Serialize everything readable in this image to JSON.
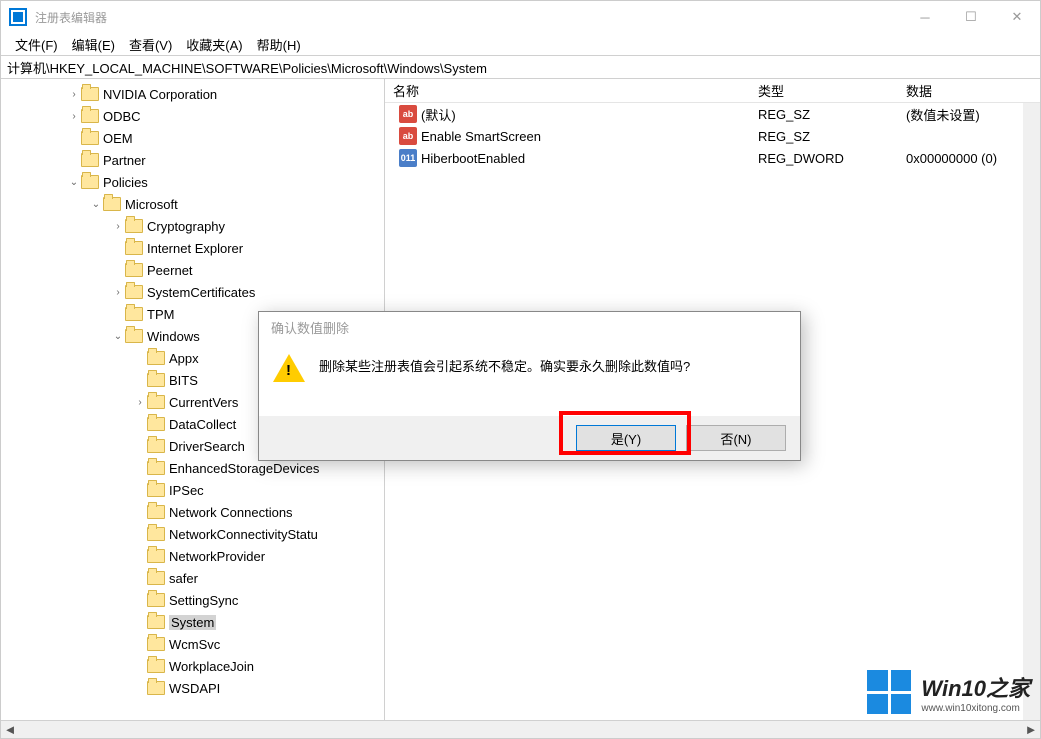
{
  "window": {
    "title": "注册表编辑器"
  },
  "menu": {
    "file": "文件(F)",
    "edit": "编辑(E)",
    "view": "查看(V)",
    "favorites": "收藏夹(A)",
    "help": "帮助(H)"
  },
  "path": "计算机\\HKEY_LOCAL_MACHINE\\SOFTWARE\\Policies\\Microsoft\\Windows\\System",
  "columns": {
    "name": "名称",
    "type": "类型",
    "data": "数据"
  },
  "values": [
    {
      "icon": "sz",
      "name": "(默认)",
      "type": "REG_SZ",
      "data": "(数值未设置)"
    },
    {
      "icon": "sz",
      "name": "Enable SmartScreen",
      "type": "REG_SZ",
      "data": ""
    },
    {
      "icon": "dw",
      "name": "HiberbootEnabled",
      "type": "REG_DWORD",
      "data": "0x00000000 (0)"
    }
  ],
  "tree": [
    {
      "indent": 3,
      "chev": "›",
      "label": "NVIDIA Corporation"
    },
    {
      "indent": 3,
      "chev": "›",
      "label": "ODBC"
    },
    {
      "indent": 3,
      "chev": "",
      "label": "OEM"
    },
    {
      "indent": 3,
      "chev": "",
      "label": "Partner"
    },
    {
      "indent": 3,
      "chev": "⌄",
      "label": "Policies"
    },
    {
      "indent": 4,
      "chev": "⌄",
      "label": "Microsoft"
    },
    {
      "indent": 5,
      "chev": "›",
      "label": "Cryptography"
    },
    {
      "indent": 5,
      "chev": "",
      "label": "Internet Explorer"
    },
    {
      "indent": 5,
      "chev": "",
      "label": "Peernet"
    },
    {
      "indent": 5,
      "chev": "›",
      "label": "SystemCertificates"
    },
    {
      "indent": 5,
      "chev": "",
      "label": "TPM"
    },
    {
      "indent": 5,
      "chev": "⌄",
      "label": "Windows"
    },
    {
      "indent": 6,
      "chev": "",
      "label": "Appx"
    },
    {
      "indent": 6,
      "chev": "",
      "label": "BITS"
    },
    {
      "indent": 6,
      "chev": "›",
      "label": "CurrentVers"
    },
    {
      "indent": 6,
      "chev": "",
      "label": "DataCollect"
    },
    {
      "indent": 6,
      "chev": "",
      "label": "DriverSearch"
    },
    {
      "indent": 6,
      "chev": "",
      "label": "EnhancedStorageDevices"
    },
    {
      "indent": 6,
      "chev": "",
      "label": "IPSec"
    },
    {
      "indent": 6,
      "chev": "",
      "label": "Network Connections"
    },
    {
      "indent": 6,
      "chev": "",
      "label": "NetworkConnectivityStatu"
    },
    {
      "indent": 6,
      "chev": "",
      "label": "NetworkProvider"
    },
    {
      "indent": 6,
      "chev": "",
      "label": "safer"
    },
    {
      "indent": 6,
      "chev": "",
      "label": "SettingSync"
    },
    {
      "indent": 6,
      "chev": "",
      "label": "System",
      "selected": true
    },
    {
      "indent": 6,
      "chev": "",
      "label": "WcmSvc"
    },
    {
      "indent": 6,
      "chev": "",
      "label": "WorkplaceJoin"
    },
    {
      "indent": 6,
      "chev": "",
      "label": "WSDAPI"
    }
  ],
  "dialog": {
    "title": "确认数值删除",
    "message": "删除某些注册表值会引起系统不稳定。确实要永久删除此数值吗?",
    "yes": "是(Y)",
    "no": "否(N)"
  },
  "watermark": {
    "title": "Win10之家",
    "url": "www.win10xitong.com"
  }
}
